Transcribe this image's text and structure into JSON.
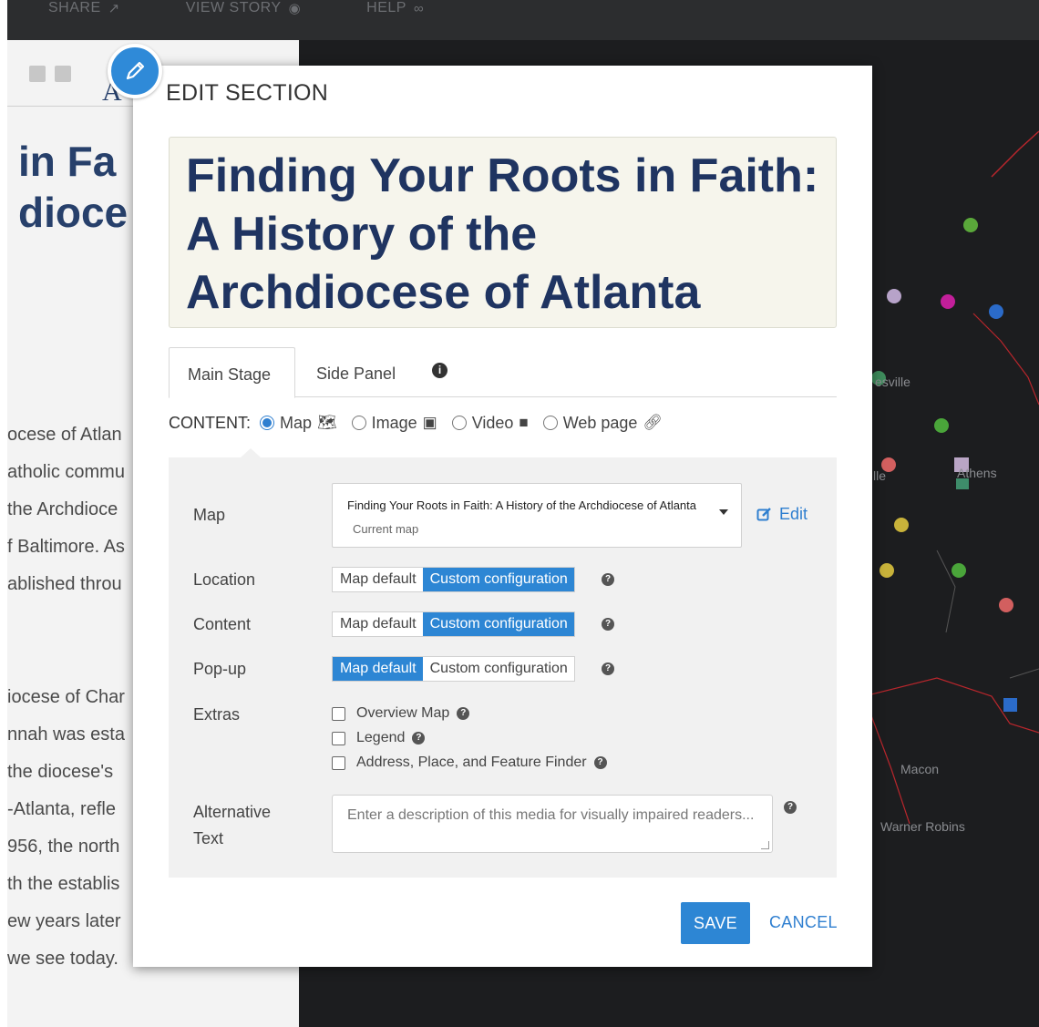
{
  "topbar": {
    "share": "SHARE",
    "view_story": "VIEW STORY",
    "help": "HELP"
  },
  "story": {
    "title_line1": "in Fa",
    "title_line2": "dioce",
    "header_letter": "A",
    "body_lines": [
      "ocese of Atlan",
      "atholic commu",
      "the Archdioce",
      "f Baltimore. As",
      "ablished throu",
      "iocese of Char",
      "nnah was esta",
      "the diocese's",
      "-Atlanta, refle",
      "956, the north",
      "th the establis",
      "ew years later",
      "we see today."
    ]
  },
  "map": {
    "labels": [
      "esville",
      "Athens",
      "lle",
      "Macon",
      "Warner Robins"
    ],
    "colors": {
      "background": "#1c1d1f",
      "boundary": "#b8262c"
    }
  },
  "modal": {
    "title": "EDIT SECTION",
    "section_title": "Finding Your Roots in Faith: A History of the Archdiocese of Atlanta",
    "tabs": [
      {
        "label": "Main Stage",
        "active": true
      },
      {
        "label": "Side Panel",
        "active": false
      }
    ],
    "content": {
      "label": "CONTENT:",
      "options": [
        {
          "label": "Map",
          "icon": "map-icon",
          "selected": true
        },
        {
          "label": "Image",
          "icon": "camera-icon",
          "selected": false
        },
        {
          "label": "Video",
          "icon": "video-icon",
          "selected": false
        },
        {
          "label": "Web page",
          "icon": "link-icon",
          "selected": false
        }
      ]
    },
    "map_field": {
      "label": "Map",
      "selected": "Finding Your Roots in Faith: A History of the Archdiocese of Atlanta",
      "sublabel": "Current map",
      "edit_label": "Edit"
    },
    "location": {
      "label": "Location",
      "options": [
        "Map default",
        "Custom configuration"
      ],
      "selected": "Custom configuration"
    },
    "content_cfg": {
      "label": "Content",
      "options": [
        "Map default",
        "Custom configuration"
      ],
      "selected": "Custom configuration"
    },
    "popup": {
      "label": "Pop-up",
      "options": [
        "Map default",
        "Custom configuration"
      ],
      "selected": "Map default"
    },
    "extras": {
      "label": "Extras",
      "items": [
        {
          "label": "Overview Map",
          "checked": false
        },
        {
          "label": "Legend",
          "checked": false
        },
        {
          "label": "Address, Place, and Feature Finder",
          "checked": false
        }
      ]
    },
    "alt_text": {
      "label_line1": "Alternative",
      "label_line2": "Text",
      "placeholder": "Enter a description of this media for visually impaired readers..."
    },
    "save_label": "SAVE",
    "cancel_label": "CANCEL",
    "colors": {
      "accent": "#2d86d4",
      "title_text": "#1f3461",
      "title_bg": "#f6f5ec"
    }
  }
}
